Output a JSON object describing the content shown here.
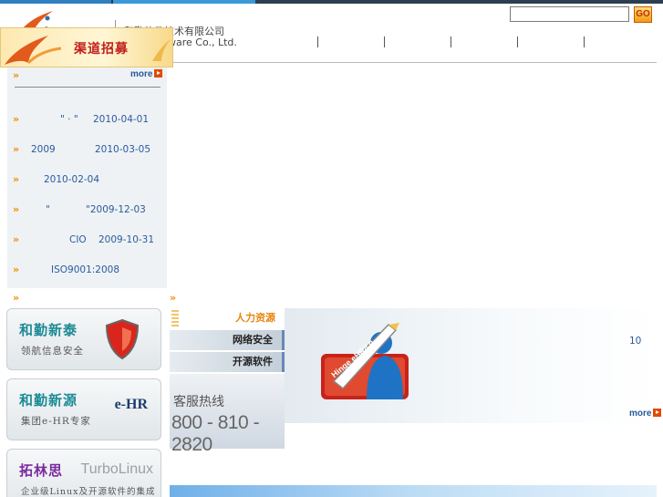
{
  "header": {
    "company_cn": "和勤软件技术有限公司",
    "company_en": "ware Co., Ltd.",
    "search_placeholder": "",
    "go_label": "GO"
  },
  "channel": {
    "title": "渠道招募"
  },
  "news": {
    "more_label": "more",
    "items": [
      {
        "title": "\"  ·  \"",
        "date": "2010-04-01"
      },
      {
        "title": "2009",
        "date": "2010-03-05"
      },
      {
        "title": "",
        "date": "2010-02-04"
      },
      {
        "title": "\"",
        "date": "\"2009-12-03"
      },
      {
        "title": "CIO",
        "date": "2009-10-31"
      },
      {
        "title": "ISO9001:2008",
        "date": ""
      }
    ]
  },
  "products": [
    {
      "name": "和勤新泰",
      "slogan": "领航信息安全",
      "mark": ""
    },
    {
      "name": "和勤新源",
      "slogan": "集团e-HR专家",
      "mark": "e-HR"
    },
    {
      "name": "拓林思",
      "slogan": "企业级Linux及开源软件的集成商",
      "mark": "TurboLinux"
    }
  ],
  "tabs": [
    {
      "label": "人力资源",
      "active": true
    },
    {
      "label": "网络安全",
      "active": false
    },
    {
      "label": "开源软件",
      "active": false
    }
  ],
  "hotline": {
    "label": "客服热线",
    "number": "800 - 810 - 2820"
  },
  "content": {
    "text": "10",
    "more_label": "more",
    "image_label": "Hinge eHR4.0"
  },
  "colors": {
    "accent_orange": "#f08c00",
    "link_blue": "#2b5a9e",
    "brand_teal": "#1c8a95"
  }
}
